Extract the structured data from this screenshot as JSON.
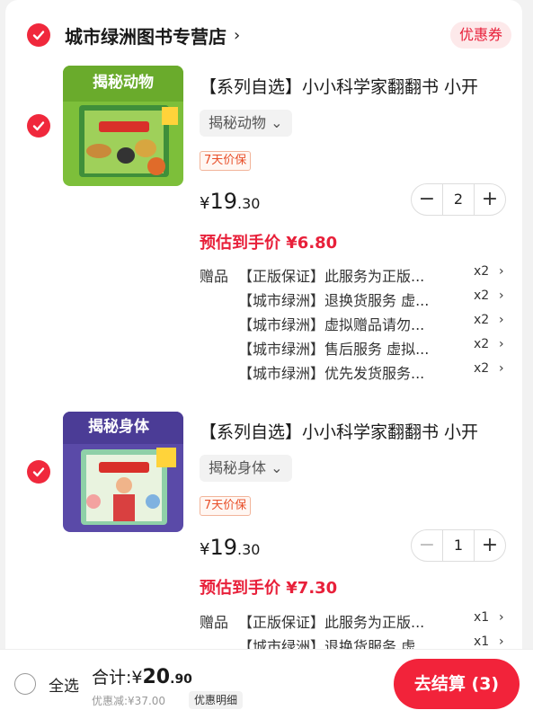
{
  "store": {
    "name": "城市绿洲图书专营店",
    "arrow": "›",
    "coupon_label": "优惠券"
  },
  "items": [
    {
      "selected": true,
      "thumb_title": "揭秘动物",
      "title": "【系列自选】小小科学家翻翻书 小开",
      "spec": "揭秘动物 ⌄",
      "tag": "7天价保",
      "price": {
        "currency": "¥",
        "int": "19",
        "dec": ".30"
      },
      "quantity": "2",
      "estimate": "预估到手价 ¥6.80",
      "gift_label": "赠品",
      "gifts": [
        {
          "text": "【正版保证】此服务为正版...",
          "qty": "x2",
          "arrow": "›"
        },
        {
          "text": "【城市绿洲】退换货服务 虚...",
          "qty": "x2",
          "arrow": "›"
        },
        {
          "text": "【城市绿洲】虚拟赠品请勿...",
          "qty": "x2",
          "arrow": "›"
        },
        {
          "text": "【城市绿洲】售后服务 虚拟...",
          "qty": "x2",
          "arrow": "›"
        },
        {
          "text": "【城市绿洲】优先发货服务...",
          "qty": "x2",
          "arrow": "›"
        }
      ]
    },
    {
      "selected": true,
      "thumb_title": "揭秘身体",
      "title": "【系列自选】小小科学家翻翻书 小开",
      "spec": "揭秘身体 ⌄",
      "tag": "7天价保",
      "price": {
        "currency": "¥",
        "int": "19",
        "dec": ".30"
      },
      "quantity": "1",
      "estimate": "预估到手价 ¥7.30",
      "gift_label": "赠品",
      "gifts": [
        {
          "text": "【正版保证】此服务为正版...",
          "qty": "x1",
          "arrow": "›"
        },
        {
          "text": "【城市绿洲】退换货服务 虚...",
          "qty": "x1",
          "arrow": "›"
        }
      ]
    }
  ],
  "stepper": {
    "minus": "−",
    "plus": "+"
  },
  "bottom": {
    "select_all": "全选",
    "total_label": "合计:",
    "total_currency": "¥",
    "total_int": "20",
    "total_dec": ".90",
    "discount": "优惠减:¥37.00",
    "discount_detail": "优惠明细",
    "checkout": "去结算 (3)"
  },
  "colors": {
    "accent": "#f2233a",
    "estimate": "#e8203a"
  }
}
